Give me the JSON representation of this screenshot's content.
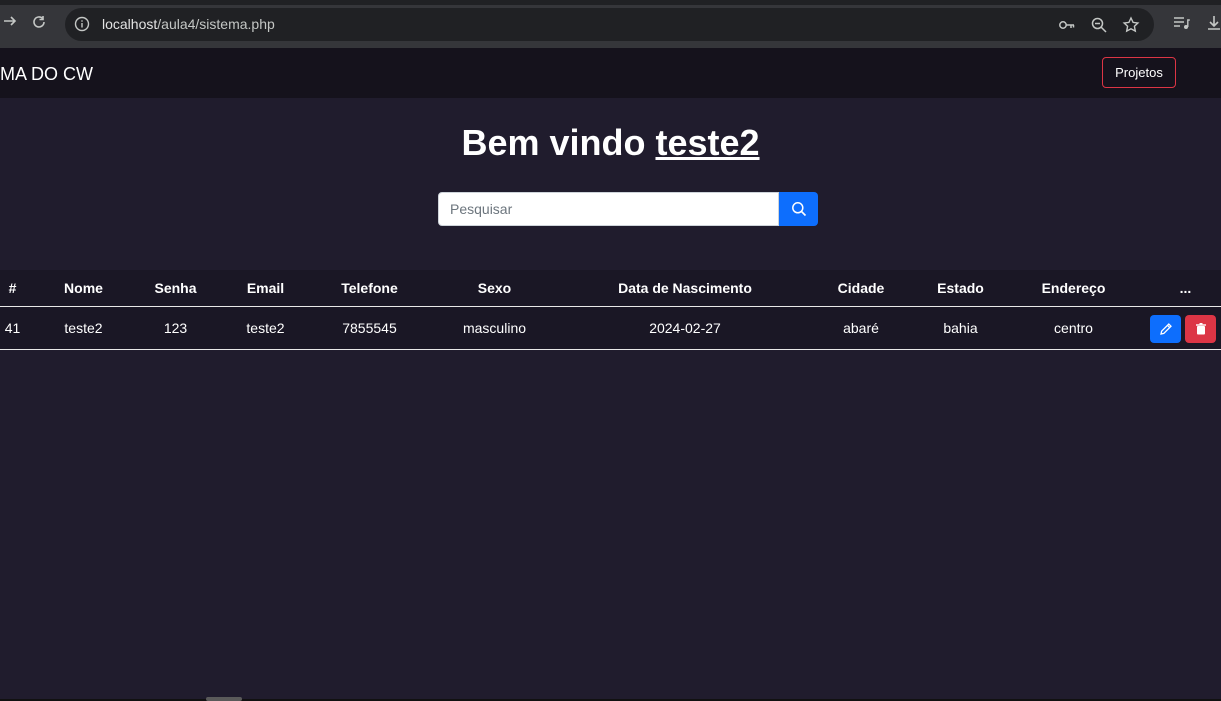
{
  "browser": {
    "url_host": "localhost",
    "url_path": "/aula4/sistema.php"
  },
  "navbar": {
    "brand": "MA DO CW",
    "projetos_label": "Projetos"
  },
  "welcome": {
    "prefix": "Bem vindo ",
    "user": "teste2"
  },
  "search": {
    "placeholder": "Pesquisar"
  },
  "table": {
    "headers": [
      "#",
      "Nome",
      "Senha",
      "Email",
      "Telefone",
      "Sexo",
      "Data de Nascimento",
      "Cidade",
      "Estado",
      "Endereço",
      "..."
    ],
    "rows": [
      [
        "41",
        "teste2",
        "123",
        "teste2",
        "7855545",
        "masculino",
        "2024-02-27",
        "abaré",
        "bahia",
        "centro"
      ]
    ]
  },
  "colors": {
    "background": "#201c2d",
    "navbar": "#15121c",
    "primary": "#0d6efd",
    "danger": "#dc3545"
  }
}
